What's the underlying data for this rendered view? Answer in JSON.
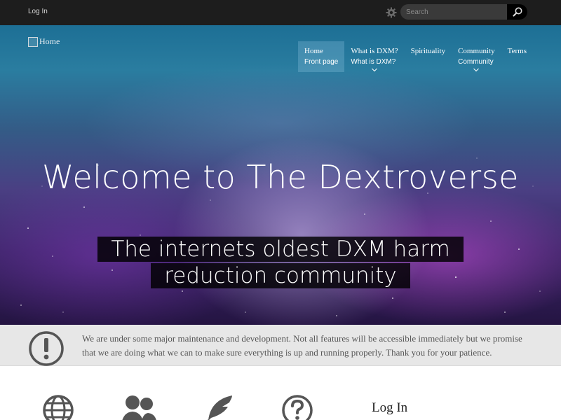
{
  "topbar": {
    "login_label": "Log In",
    "search_placeholder": "Search",
    "icons": [
      "gear-icon",
      "search-icon"
    ]
  },
  "hero": {
    "logo_alt": "Home",
    "headline": "Welcome to The Dextroverse",
    "tagline": "The internets oldest DXM harm reduction community"
  },
  "nav": {
    "items": [
      {
        "label": "Home",
        "sub": "Front page",
        "active": true
      },
      {
        "label": "What is DXM?",
        "sub": "What is DXM?",
        "dropdown": true
      },
      {
        "label": "Spirituality",
        "sub": ""
      },
      {
        "label": "Community",
        "sub": "Community",
        "dropdown": true
      },
      {
        "label": "Terms",
        "sub": ""
      }
    ]
  },
  "notice": {
    "text": "We are under some major maintenance and development. Not all features will be accessible immediately but we promise that we are doing what we can to make sure everything is up and running properly. Thank you for your patience.",
    "icon": "exclamation-circle-icon"
  },
  "features": {
    "icons": [
      "globe-icon",
      "users-icon",
      "feather-icon",
      "question-icon"
    ],
    "login_heading": "Log In"
  },
  "colors": {
    "topbar_bg": "#1d1d1d",
    "notice_bg": "#e7e7e7",
    "icon_gray": "#555555"
  }
}
